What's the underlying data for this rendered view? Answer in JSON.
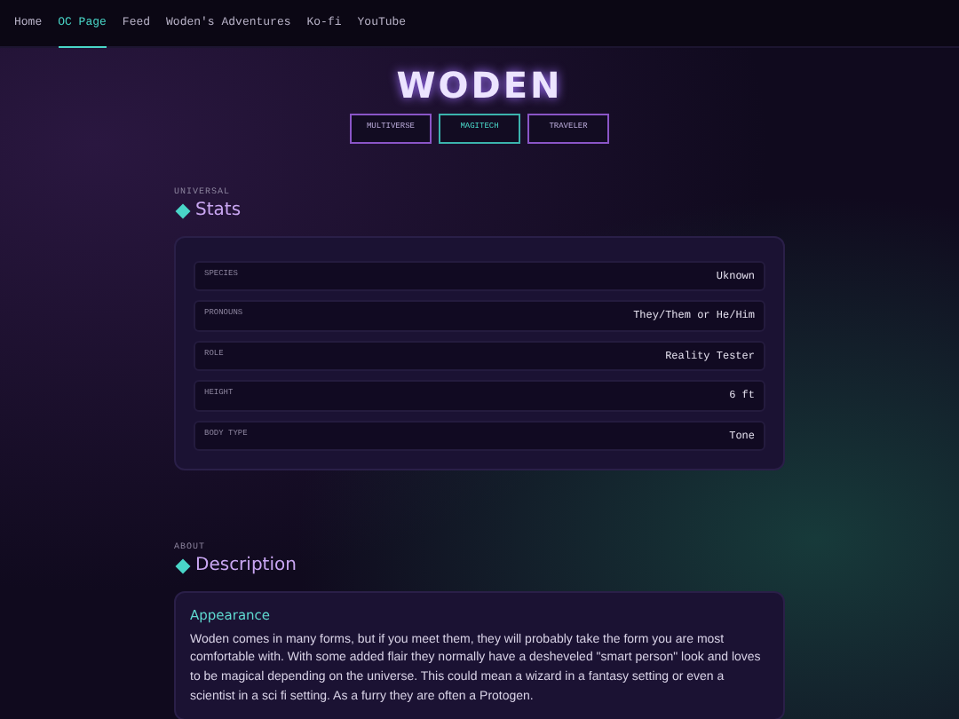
{
  "nav": [
    {
      "label": "Home",
      "selected": false
    },
    {
      "label": "OC Page",
      "selected": true
    },
    {
      "label": "Feed",
      "selected": false
    },
    {
      "label": "Woden's Adventures",
      "selected": false
    },
    {
      "label": "Ko-fi",
      "selected": false
    },
    {
      "label": "YouTube",
      "selected": false
    }
  ],
  "title": "WODEN",
  "filters": [
    {
      "label": "MULTIVERSE",
      "selected": false
    },
    {
      "label": "MAGITECH",
      "selected": true
    },
    {
      "label": "TRAVELER",
      "selected": false
    }
  ],
  "sections": [
    {
      "eyebrow": "UNIVERSAL",
      "heading": "Stats",
      "kind": "stats",
      "rows": [
        {
          "label": "SPECIES",
          "value": "Uknown"
        },
        {
          "label": "PRONOUNS",
          "value": "They/Them or He/Him"
        },
        {
          "label": "ROLE",
          "value": "Reality Tester"
        },
        {
          "label": "HEIGHT",
          "value": "6 ft"
        },
        {
          "label": "BODY TYPE",
          "value": "Tone"
        }
      ]
    },
    {
      "eyebrow": "ABOUT",
      "heading": "Description",
      "kind": "text",
      "subheading": "Appearance",
      "body": "Woden comes in many forms, but if you meet them, they will probably take the form you are most comfortable with. With some added flair they normally have a desheveled \"smart person\" look and loves to be magical depending on the universe. This could mean a wizard in a fantasy setting or even a scientist in a sci fi setting. As a furry they are often a Protogen."
    }
  ]
}
